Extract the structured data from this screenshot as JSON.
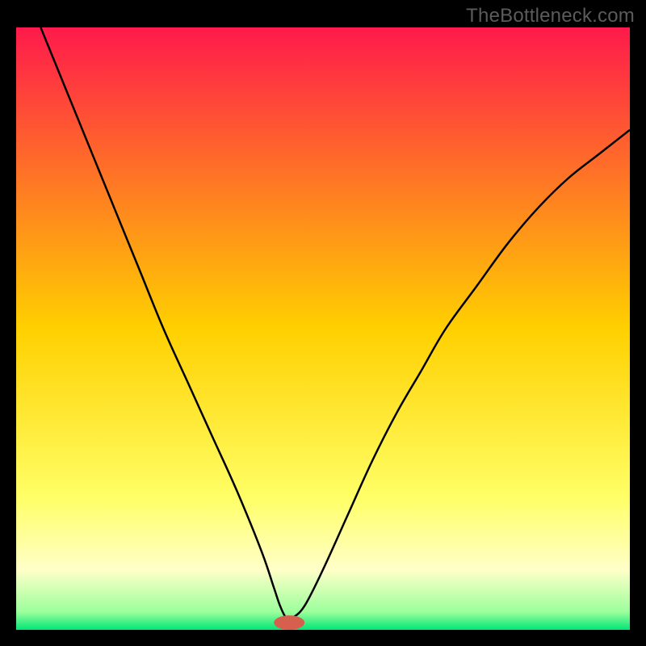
{
  "watermark": "TheBottleneck.com",
  "chart_data": {
    "type": "line",
    "title": "",
    "xlabel": "",
    "ylabel": "",
    "xlim": [
      0,
      100
    ],
    "ylim": [
      0,
      100
    ],
    "background_gradient": {
      "stops": [
        {
          "offset": 0,
          "color": "#ff1a4b"
        },
        {
          "offset": 50,
          "color": "#ffd000"
        },
        {
          "offset": 78,
          "color": "#ffff66"
        },
        {
          "offset": 90,
          "color": "#ffffc8"
        },
        {
          "offset": 97,
          "color": "#9cff9c"
        },
        {
          "offset": 100,
          "color": "#00e676"
        }
      ]
    },
    "series": [
      {
        "name": "bottleneck-curve",
        "color": "#000000",
        "width": 2.5,
        "x": [
          4,
          8,
          12,
          16,
          20,
          24,
          28,
          32,
          36,
          40,
          42,
          43,
          44,
          45,
          47,
          50,
          54,
          58,
          62,
          66,
          70,
          75,
          80,
          85,
          90,
          95,
          100
        ],
        "y": [
          100,
          90,
          80,
          70,
          60,
          50,
          41,
          32,
          23,
          13,
          7,
          4,
          2,
          2,
          4,
          10,
          19,
          28,
          36,
          43,
          50,
          57,
          64,
          70,
          75,
          79,
          83
        ]
      }
    ],
    "marker": {
      "name": "optimal-point",
      "color": "#d6604d",
      "x": 44.5,
      "y": 1.2,
      "rx": 2.5,
      "ry": 1.2
    }
  }
}
